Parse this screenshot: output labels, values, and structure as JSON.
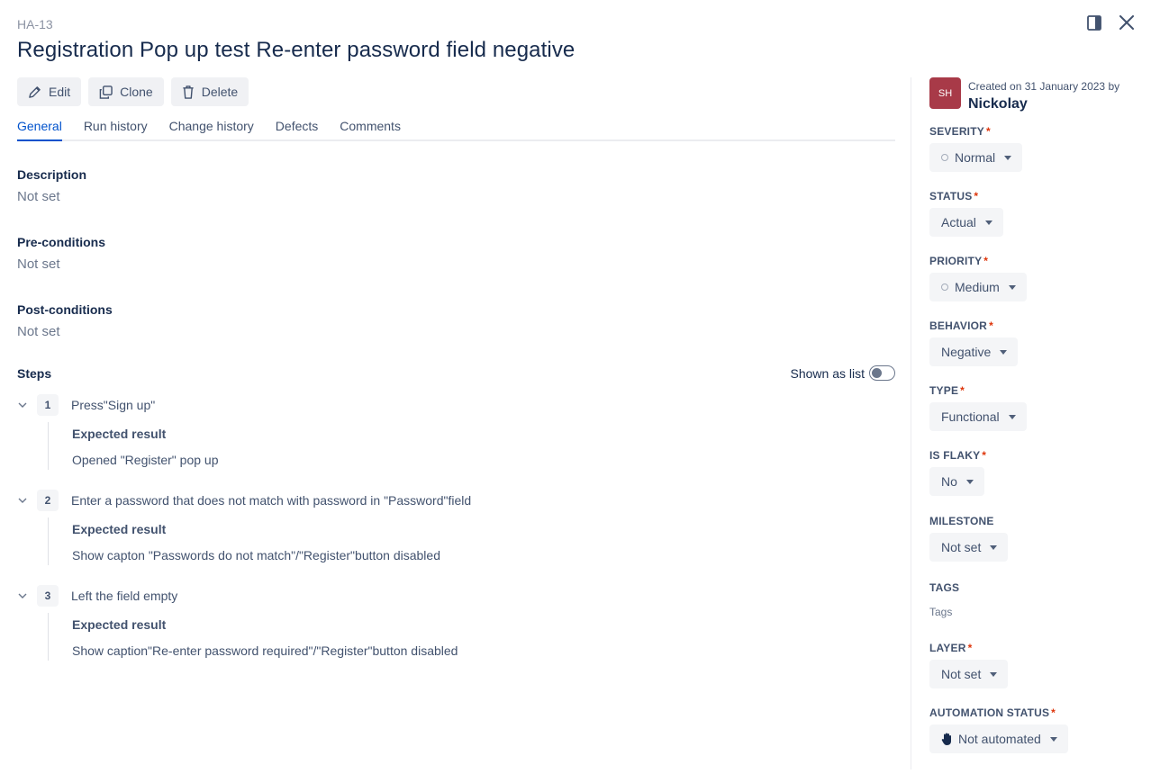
{
  "case_key": "HA-13",
  "title": "Registration Pop up test Re-enter password field negative",
  "toolbar": {
    "edit_label": "Edit",
    "clone_label": "Clone",
    "delete_label": "Delete"
  },
  "tabs": [
    {
      "label": "General"
    },
    {
      "label": "Run history"
    },
    {
      "label": "Change history"
    },
    {
      "label": "Defects"
    },
    {
      "label": "Comments"
    }
  ],
  "description": {
    "label": "Description",
    "value": "Not set"
  },
  "preconditions": {
    "label": "Pre-conditions",
    "value": "Not set"
  },
  "postconditions": {
    "label": "Post-conditions",
    "value": "Not set"
  },
  "steps": {
    "label": "Steps",
    "toggle_label": "Shown as list",
    "expected_label": "Expected result",
    "items": [
      {
        "num": "1",
        "action": "Press\"Sign up\"",
        "expected": "Opened \"Register\" pop up"
      },
      {
        "num": "2",
        "action": "Enter a password that does not match with password in \"Password\"field",
        "expected": "Show capton \"Passwords do not match\"/\"Register\"button disabled"
      },
      {
        "num": "3",
        "action": "Left the field empty",
        "expected": "Show caption\"Re-enter password required\"/\"Register\"button disabled"
      }
    ]
  },
  "sidebar": {
    "avatar_initials": "SH",
    "created_text": "Created on 31 January 2023 by",
    "author": "Nickolay",
    "severity": {
      "label": "SEVERITY",
      "value": "Normal"
    },
    "status": {
      "label": "STATUS",
      "value": "Actual"
    },
    "priority": {
      "label": "PRIORITY",
      "value": "Medium"
    },
    "behavior": {
      "label": "BEHAVIOR",
      "value": "Negative"
    },
    "type": {
      "label": "TYPE",
      "value": "Functional"
    },
    "is_flaky": {
      "label": "IS FLAKY",
      "value": "No"
    },
    "milestone": {
      "label": "MILESTONE",
      "value": "Not set"
    },
    "tags": {
      "label": "TAGS",
      "value": "Tags"
    },
    "layer": {
      "label": "LAYER",
      "value": "Not set"
    },
    "automation_status": {
      "label": "AUTOMATION STATUS",
      "value": "Not automated"
    },
    "required_mark": "*"
  },
  "colors": {
    "accent": "#0052cc",
    "avatar": "#a83a48",
    "required": "#de350b"
  }
}
